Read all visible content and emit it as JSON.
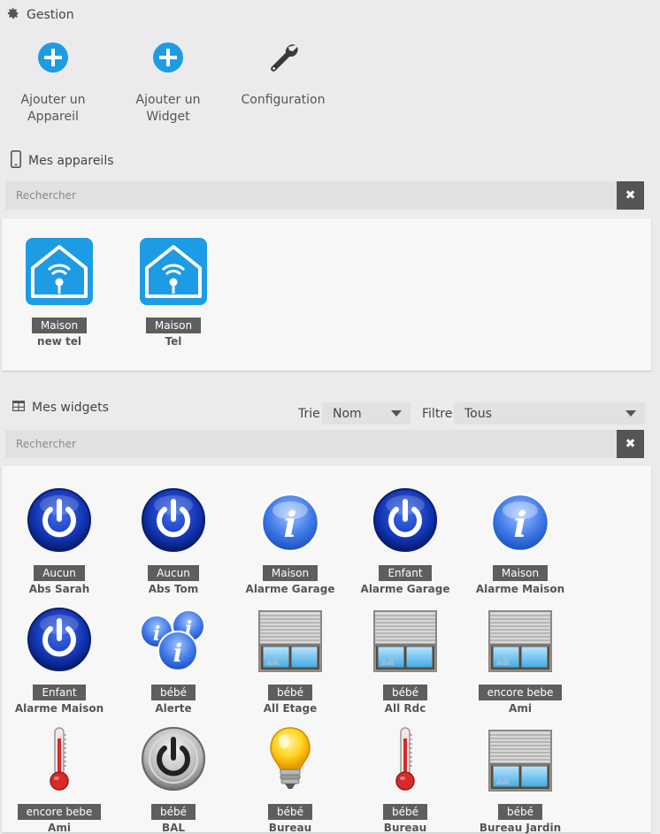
{
  "gestion": {
    "title": "Gestion",
    "actions": [
      {
        "label": "Ajouter un\nAppareil",
        "icon": "plus-circle-icon"
      },
      {
        "label": "Ajouter un Widget",
        "icon": "plus-circle-icon"
      },
      {
        "label": "Configuration",
        "icon": "wrench-icon"
      }
    ]
  },
  "devices": {
    "title": "Mes appareils",
    "search_placeholder": "Rechercher",
    "clear": "✖",
    "items": [
      {
        "badge": "Maison",
        "name": "new tel"
      },
      {
        "badge": "Maison",
        "name": "Tel"
      }
    ]
  },
  "widgets": {
    "title": "Mes widgets",
    "sort_label": "Trie",
    "sort_value": "Nom",
    "filter_label": "Filtre",
    "filter_value": "Tous",
    "search_placeholder": "Rechercher",
    "clear": "✖",
    "items": [
      {
        "badge": "Aucun",
        "name": "Abs Sarah",
        "icon": "power-icon"
      },
      {
        "badge": "Aucun",
        "name": "Abs Tom",
        "icon": "power-icon"
      },
      {
        "badge": "Maison",
        "name": "Alarme Garage",
        "icon": "info-icon"
      },
      {
        "badge": "Enfant",
        "name": "Alarme Garage",
        "icon": "power-icon"
      },
      {
        "badge": "Maison",
        "name": "Alarme Maison",
        "icon": "info-icon"
      },
      {
        "badge": "Enfant",
        "name": "Alarme Maison",
        "icon": "power-icon"
      },
      {
        "badge": "bébé",
        "name": "Alerte",
        "icon": "multi-info-icon"
      },
      {
        "badge": "bébé",
        "name": "All Etage",
        "icon": "shutter-icon"
      },
      {
        "badge": "bébé",
        "name": "All Rdc",
        "icon": "shutter-icon"
      },
      {
        "badge": "encore bebe",
        "name": "Ami",
        "icon": "shutter-icon"
      },
      {
        "badge": "encore bebe",
        "name": "Ami",
        "icon": "thermometer-icon"
      },
      {
        "badge": "bébé",
        "name": "BAL",
        "icon": "metal-power-icon"
      },
      {
        "badge": "bébé",
        "name": "Bureau",
        "icon": "bulb-icon"
      },
      {
        "badge": "bébé",
        "name": "Bureau",
        "icon": "thermometer-icon"
      },
      {
        "badge": "bébé",
        "name": "Bureau Jardin",
        "icon": "shutter-icon"
      }
    ]
  },
  "colors": {
    "accent": "#1d9ce5",
    "badge": "#5e5e5e",
    "power_blue": "#1533a8"
  }
}
